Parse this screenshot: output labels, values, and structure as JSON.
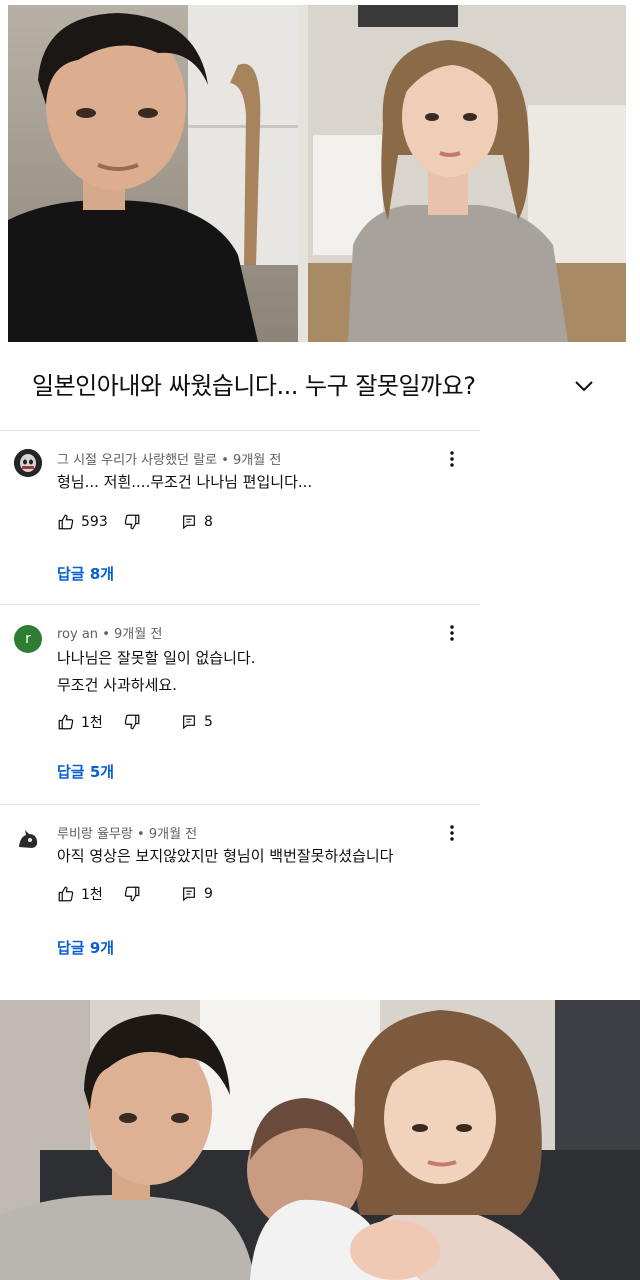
{
  "video": {
    "title": "일본인아내와 싸웠습니다... 누구 잘못일까요?"
  },
  "comments": [
    {
      "author": "그 시절 우리가 사랑했던 랄로",
      "time": "9개월 전",
      "lines": [
        "형님... 저흰....무조건 나나님 편입니다..."
      ],
      "likes": "593",
      "replies_count": "8",
      "replies_label": "답글 8개"
    },
    {
      "author": "roy an",
      "avatar_letter": "r",
      "time": "9개월 전",
      "lines": [
        "나나님은 잘못할 일이 없습니다.",
        "무조건 사과하세요."
      ],
      "likes": "1천",
      "replies_count": "5",
      "replies_label": "답글 5개"
    },
    {
      "author": "루비랑 율무랑",
      "time": "9개월 전",
      "lines": [
        "아직 영상은 보지않았지만 형님이 백번잘못하셨습니다"
      ],
      "likes": "1천",
      "replies_count": "9",
      "replies_label": "답글 9개"
    }
  ],
  "separator": "•",
  "colors": {
    "link": "#065fd4",
    "meta": "#606060",
    "divider": "#e5e5e5",
    "avatar_green": "#2e7d32"
  },
  "icons": [
    "chevron-down-icon",
    "more-vert-icon",
    "thumb-up-icon",
    "thumb-down-icon",
    "reply-icon"
  ]
}
